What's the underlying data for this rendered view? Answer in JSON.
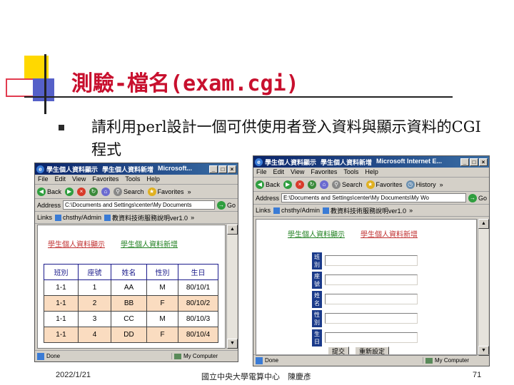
{
  "slide": {
    "title": "測驗-檔名(exam.cgi)",
    "bullet": "請利用perl設計一個可供使用者登入資料與顯示資料的CGI程式",
    "footer_date": "2022/1/21",
    "footer_center": "國立中央大學電算中心　陳慶彥",
    "page_number": "71"
  },
  "left_window": {
    "tabs": [
      "學生個人資料顯示",
      "學生個人資料新增",
      "Microsoft..."
    ],
    "menu": [
      "File",
      "Edit",
      "View",
      "Favorites",
      "Tools",
      "Help"
    ],
    "toolbar": {
      "back": "Back",
      "search": "Search",
      "favorites": "Favorites",
      "more": "»"
    },
    "address_label": "Address",
    "address_value": "C:\\Documents and Settings\\center\\My Documents",
    "go_label": "Go",
    "links_label": "Links",
    "link_1": "chsthy/Admin",
    "link_2": "教資料技術服務說明ver1.0",
    "links_more": "»",
    "page_links": [
      "學生個人資料顯示",
      "學生個人資料新增"
    ],
    "table": {
      "headers": [
        "班別",
        "座號",
        "姓名",
        "性別",
        "生日"
      ],
      "rows": [
        [
          "1-1",
          "1",
          "AA",
          "M",
          "80/10/1"
        ],
        [
          "1-1",
          "2",
          "BB",
          "F",
          "80/10/2"
        ],
        [
          "1-1",
          "3",
          "CC",
          "M",
          "80/10/3"
        ],
        [
          "1-1",
          "4",
          "DD",
          "F",
          "80/10/4"
        ]
      ],
      "highlight_color": "#fadcc0"
    },
    "status_done": "Done",
    "status_zone": "My Computer"
  },
  "right_window": {
    "tabs": [
      "學生個人資料顯示",
      "學生個人資料新增",
      "Microsoft Internet E..."
    ],
    "menu": [
      "File",
      "Edit",
      "View",
      "Favorites",
      "Tools",
      "Help"
    ],
    "toolbar": {
      "back": "Back",
      "search": "Search",
      "favorites": "Favorites",
      "history": "History",
      "more": "»"
    },
    "address_label": "Address",
    "address_value": "E:\\Documents and Settings\\center\\My Documents\\My Wo",
    "go_label": "Go",
    "links_label": "Links",
    "link_1": "chsthy/Admin",
    "link_2": "教資料技術服務說明ver1.0",
    "links_more": "»",
    "page_links": [
      "學生個人資料顯示",
      "學生個人資料新增"
    ],
    "form_labels": [
      "班別",
      "座號",
      "姓名",
      "性別",
      "生日"
    ],
    "submit_label": "提交",
    "reset_label": "重新設定",
    "status_done": "Done",
    "status_zone": "My Computer"
  },
  "colors": {
    "title_red": "#c8102e",
    "link_red": "#c03030",
    "link_green": "#208020",
    "titlebar_blue": "#0a246a"
  }
}
